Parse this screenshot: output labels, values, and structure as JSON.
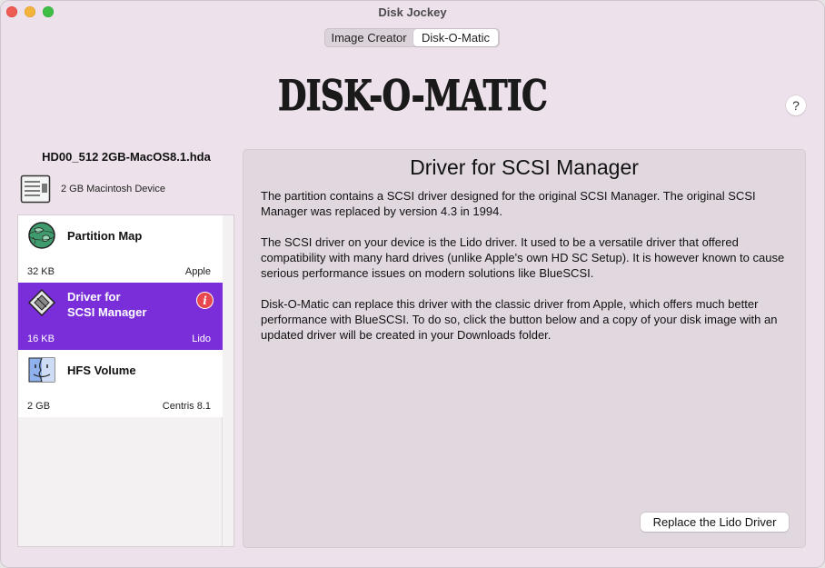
{
  "window": {
    "title": "Disk Jockey"
  },
  "tabs": [
    {
      "label": "Image Creator",
      "selected": false
    },
    {
      "label": "Disk-O-Matic",
      "selected": true
    }
  ],
  "logo": {
    "text": "DISK-O-MATIC"
  },
  "help": {
    "label": "?"
  },
  "sidebar": {
    "file_name": "HD00_512 2GB-MacOS8.1.hda",
    "device": {
      "label": "2 GB Macintosh Device",
      "icon": "hard-drive-icon"
    },
    "items": [
      {
        "title_line1": "Partition Map",
        "title_line2": "",
        "size": "32 KB",
        "tag": "Apple",
        "icon": "partition-map-globe-icon",
        "selected": false,
        "warning": false
      },
      {
        "title_line1": "Driver for",
        "title_line2": "SCSI Manager",
        "size": "16 KB",
        "tag": "Lido",
        "icon": "driver-chip-icon",
        "selected": true,
        "warning": true,
        "warning_glyph": "i"
      },
      {
        "title_line1": "HFS Volume",
        "title_line2": "",
        "size": "2 GB",
        "tag": "Centris 8.1",
        "icon": "finder-face-icon",
        "selected": false,
        "warning": false
      }
    ]
  },
  "panel": {
    "title": "Driver for SCSI Manager",
    "paragraphs": [
      "The partition contains a SCSI driver designed for the original SCSI Manager. The original SCSI Manager was replaced by version 4.3 in 1994.",
      "The SCSI driver on your device is the Lido driver. It used to be a versatile driver that offered compatibility with many hard drives (unlike Apple's own HD SC Setup). It is however known to cause serious performance issues on modern solutions like BlueSCSI.",
      "Disk-O-Matic can replace this driver with the classic driver from Apple, which offers much better performance with BlueSCSI. To do so, click the button below and a copy of your disk image with an updated driver will be created in your Downloads folder."
    ],
    "button_label": "Replace the Lido Driver"
  },
  "colors": {
    "accent": "#7a2ed9",
    "window_bg": "#ede2eb",
    "panel_bg": "#e0d7df",
    "warning": "#e8474e"
  }
}
